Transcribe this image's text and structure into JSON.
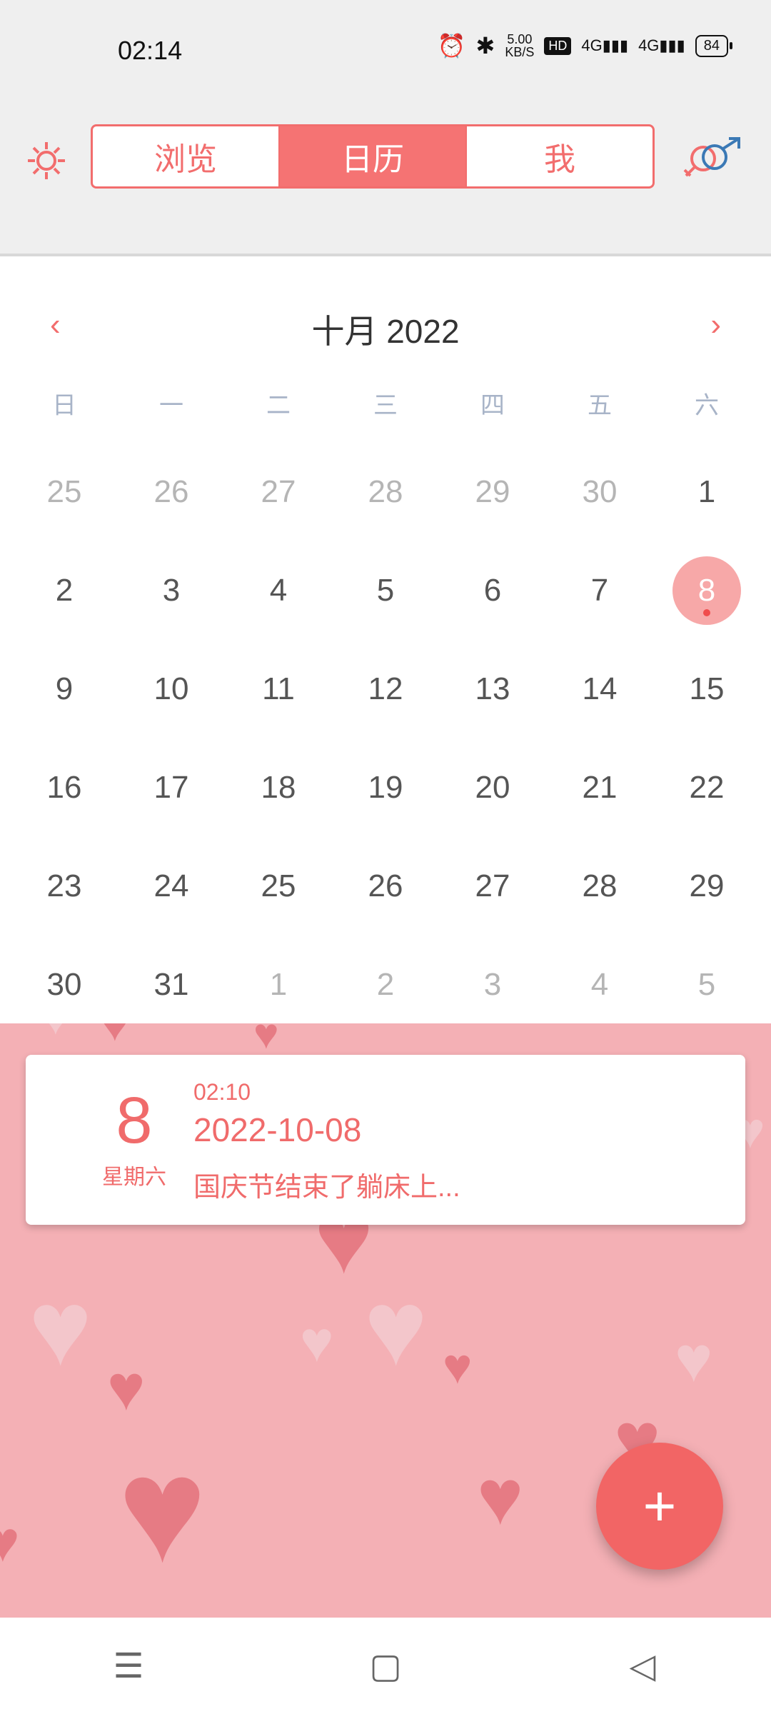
{
  "status": {
    "time": "02:14",
    "net_speed_value": "5.00",
    "net_speed_unit": "KB/S",
    "hd_label": "HD",
    "signal1": "4G",
    "signal2": "4G",
    "battery": "84"
  },
  "topbar": {
    "tabs": [
      "浏览",
      "日历",
      "我"
    ],
    "active_tab": "日历",
    "colors": {
      "accent": "#f26d6d",
      "active_bg": "#f57373"
    }
  },
  "calendar": {
    "month_title": "十月 2022",
    "prev_icon": "chevron-left-icon",
    "next_icon": "chevron-right-icon",
    "weekdays": [
      "日",
      "一",
      "二",
      "三",
      "四",
      "五",
      "六"
    ],
    "weeks": [
      [
        {
          "d": "25",
          "muted": true
        },
        {
          "d": "26",
          "muted": true
        },
        {
          "d": "27",
          "muted": true
        },
        {
          "d": "28",
          "muted": true
        },
        {
          "d": "29",
          "muted": true
        },
        {
          "d": "30",
          "muted": true
        },
        {
          "d": "1",
          "muted": false
        }
      ],
      [
        {
          "d": "2",
          "muted": false
        },
        {
          "d": "3",
          "muted": false
        },
        {
          "d": "4",
          "muted": false
        },
        {
          "d": "5",
          "muted": false
        },
        {
          "d": "6",
          "muted": false
        },
        {
          "d": "7",
          "muted": false
        },
        {
          "d": "8",
          "muted": false,
          "selected": true,
          "has_entry": true
        }
      ],
      [
        {
          "d": "9",
          "muted": false
        },
        {
          "d": "10",
          "muted": false
        },
        {
          "d": "11",
          "muted": false
        },
        {
          "d": "12",
          "muted": false
        },
        {
          "d": "13",
          "muted": false
        },
        {
          "d": "14",
          "muted": false
        },
        {
          "d": "15",
          "muted": false
        }
      ],
      [
        {
          "d": "16",
          "muted": false
        },
        {
          "d": "17",
          "muted": false
        },
        {
          "d": "18",
          "muted": false
        },
        {
          "d": "19",
          "muted": false
        },
        {
          "d": "20",
          "muted": false
        },
        {
          "d": "21",
          "muted": false
        },
        {
          "d": "22",
          "muted": false
        }
      ],
      [
        {
          "d": "23",
          "muted": false
        },
        {
          "d": "24",
          "muted": false
        },
        {
          "d": "25",
          "muted": false
        },
        {
          "d": "26",
          "muted": false
        },
        {
          "d": "27",
          "muted": false
        },
        {
          "d": "28",
          "muted": false
        },
        {
          "d": "29",
          "muted": false
        }
      ],
      [
        {
          "d": "30",
          "muted": false
        },
        {
          "d": "31",
          "muted": false
        },
        {
          "d": "1",
          "muted": true
        },
        {
          "d": "2",
          "muted": true
        },
        {
          "d": "3",
          "muted": true
        },
        {
          "d": "4",
          "muted": true
        },
        {
          "d": "5",
          "muted": true
        }
      ]
    ]
  },
  "entry": {
    "day": "8",
    "weekday": "星期六",
    "time": "02:10",
    "date": "2022-10-08",
    "text": "国庆节结束了躺床上..."
  },
  "fab": {
    "icon": "plus-icon"
  },
  "navbar": {
    "icons": [
      "menu-icon",
      "home-icon",
      "back-icon"
    ]
  }
}
